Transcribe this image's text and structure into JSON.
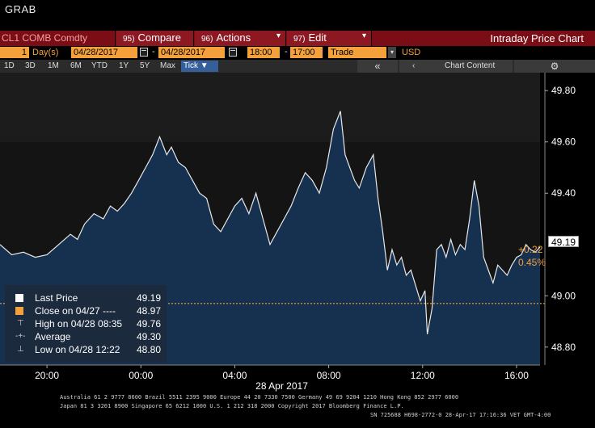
{
  "window": {
    "title": "GRAB"
  },
  "toolbar": {
    "ticker": "CL1 COMB Comdty",
    "compare": {
      "num": "95)",
      "label": "Compare"
    },
    "actions": {
      "num": "96)",
      "label": "Actions"
    },
    "edit": {
      "num": "97)",
      "label": "Edit"
    },
    "screen_title": "Intraday Price Chart"
  },
  "controls": {
    "period_count": "1",
    "period_unit": "Day(s)",
    "start_date": "04/28/2017",
    "end_date": "04/28/2017",
    "start_time": "18:00",
    "end_time": "17:00",
    "event": "Trade",
    "currency": "USD",
    "range_buttons": [
      "1D",
      "3D",
      "1M",
      "6M",
      "YTD",
      "1Y",
      "5Y",
      "Max"
    ],
    "tick_label": "Tick ▼",
    "collapse_label": "«",
    "chart_content_label": "Chart Content",
    "settings_icon": "gear-icon"
  },
  "legend": {
    "last": {
      "label": "Last Price",
      "value": "49.19"
    },
    "close": {
      "label": "Close on 04/27 ----",
      "value": "48.97"
    },
    "high": {
      "label": "High on 04/28 08:35",
      "value": "49.76"
    },
    "average": {
      "label": "Average",
      "value": "49.30"
    },
    "low": {
      "label": "Low on 04/28 12:22",
      "value": "48.80"
    }
  },
  "price_tags": {
    "last": "49.19",
    "change": "+0.22",
    "change_pct": "0.45%"
  },
  "colors": {
    "toolbar_red": "#8e1822",
    "orange": "#f4a13c",
    "area_fill": "#16304f",
    "plot_bg": "#1c1c1c",
    "close_line": "#f4a13c"
  },
  "chart_data": {
    "type": "area",
    "x_tick_labels": [
      "20:00",
      "00:00",
      "04:00",
      "08:00",
      "12:00",
      "16:00"
    ],
    "x_ticks_hours": [
      20,
      24,
      28,
      32,
      36,
      40
    ],
    "x_range_hours": [
      18,
      41
    ],
    "date_label": "28 Apr 2017",
    "y_tick_labels": [
      "49.80",
      "49.60",
      "49.40",
      "49.00",
      "48.80"
    ],
    "y_ticks": [
      49.8,
      49.6,
      49.4,
      49.0,
      48.8
    ],
    "ylim": [
      48.73,
      49.87
    ],
    "close_value": 48.97,
    "last_value": 49.19,
    "series": [
      {
        "x": [
          18.0,
          18.5,
          19.0,
          19.5,
          20.0,
          20.5,
          21.0,
          21.3,
          21.6,
          22.0,
          22.4,
          22.7,
          23.0,
          23.3,
          23.6,
          23.9,
          24.2,
          24.5,
          24.8,
          25.1,
          25.3,
          25.6,
          25.9,
          26.2,
          26.5,
          26.8,
          27.1,
          27.4,
          27.7,
          28.0,
          28.3,
          28.6,
          28.9,
          29.2,
          29.5,
          29.8,
          30.1,
          30.4,
          30.7,
          31.0,
          31.3,
          31.6,
          31.9,
          32.2,
          32.5,
          32.7,
          32.9,
          33.1,
          33.3,
          33.6,
          33.9,
          34.1,
          34.3,
          34.5,
          34.7,
          34.9,
          35.1,
          35.3,
          35.5,
          35.7,
          35.9,
          36.1,
          36.2,
          36.4,
          36.6,
          36.8,
          37.0,
          37.2,
          37.4,
          37.6,
          37.8,
          38.0,
          38.2,
          38.4,
          38.6,
          38.8,
          39.0,
          39.2,
          39.4,
          39.6,
          39.8,
          40.0,
          40.2,
          40.4,
          40.6,
          40.8,
          41.0
        ],
        "y": [
          49.2,
          49.16,
          49.17,
          49.15,
          49.16,
          49.2,
          49.24,
          49.22,
          49.28,
          49.32,
          49.3,
          49.35,
          49.33,
          49.36,
          49.4,
          49.45,
          49.5,
          49.55,
          49.62,
          49.55,
          49.58,
          49.52,
          49.5,
          49.45,
          49.4,
          49.38,
          49.28,
          49.25,
          49.3,
          49.35,
          49.38,
          49.32,
          49.4,
          49.3,
          49.2,
          49.25,
          49.3,
          49.35,
          49.42,
          49.48,
          49.45,
          49.4,
          49.5,
          49.65,
          49.72,
          49.55,
          49.5,
          49.45,
          49.42,
          49.5,
          49.55,
          49.38,
          49.25,
          49.1,
          49.18,
          49.12,
          49.15,
          49.08,
          49.1,
          49.04,
          48.98,
          49.02,
          48.85,
          48.95,
          49.18,
          49.2,
          49.15,
          49.22,
          49.16,
          49.2,
          49.18,
          49.3,
          49.45,
          49.35,
          49.15,
          49.1,
          49.05,
          49.12,
          49.1,
          49.08,
          49.12,
          49.15,
          49.16,
          49.2,
          49.18,
          49.17,
          49.19
        ]
      }
    ]
  },
  "footer": {
    "line1": "Australia 61 2 9777 8600 Brazil 5511 2395 9000 Europe 44 20 7330 7500 Germany 49 69 9204 1210 Hong Kong 852 2977 6000",
    "line2": "Japan 81 3 3201 8900        Singapore 65 6212 1000        U.S. 1 212 318 2000        Copyright 2017 Bloomberg Finance L.P.",
    "line3": "SN 725688 H698-2772-0 28-Apr-17 17:16:36 VET  GMT-4:00"
  }
}
